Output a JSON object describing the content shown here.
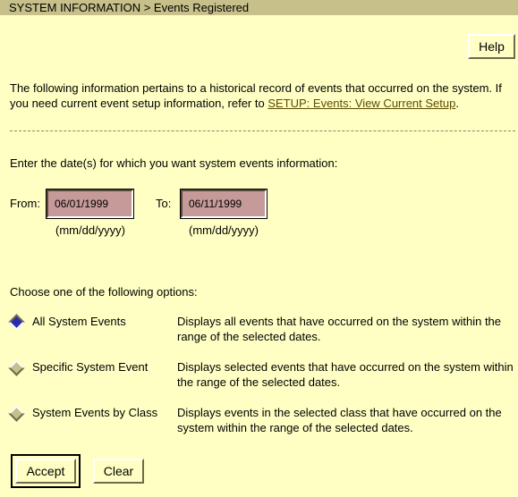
{
  "header": {
    "title": "SYSTEM INFORMATION > Events Registered"
  },
  "toolbar": {
    "help_label": "Help"
  },
  "intro": {
    "text_before_link": "The following information pertains to a historical record of events that occurred on the system. If you need current event setup information, refer to ",
    "link_text": "SETUP: Events: View Current Setup",
    "text_after_link": "."
  },
  "date_range": {
    "prompt": "Enter the date(s) for which you want system events information:",
    "from_label": "From:",
    "from_value": "06/01/1999",
    "to_label": "To:",
    "to_value": "06/11/1999",
    "format_hint": "(mm/dd/yyyy)"
  },
  "options": {
    "prompt": "Choose one of the following options:",
    "selected_index": 0,
    "items": [
      {
        "label": "All System Events",
        "description": "Displays all events that have occurred on the system within the range of the selected dates."
      },
      {
        "label": "Specific System Event",
        "description": "Displays selected events that have occurred on the system within the range of the selected dates."
      },
      {
        "label": "System Events by Class",
        "description": "Displays events in the selected class that have occurred on the system within the range of the selected dates."
      }
    ]
  },
  "actions": {
    "accept_label": "Accept",
    "clear_label": "Clear"
  },
  "colors": {
    "background": "#FFFFC4",
    "title_bar": "#C7C08A",
    "date_field": "#C79A9A",
    "radio_selected": "#2A2AB0",
    "link": "#5E4B00"
  }
}
